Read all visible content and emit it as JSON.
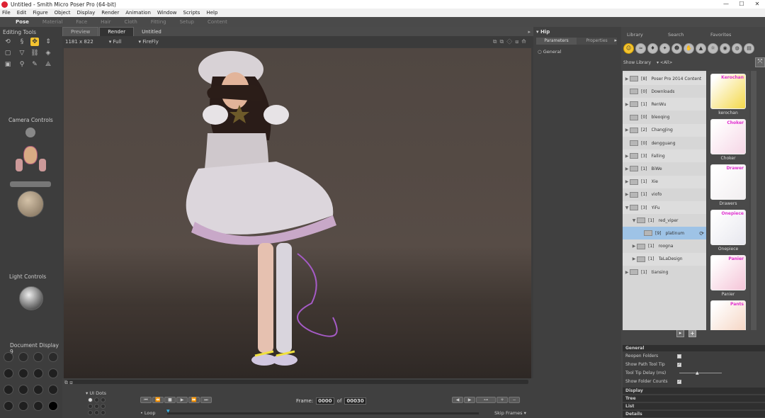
{
  "titlebar": {
    "title": "Untitled - Smith Micro Poser Pro  (64-bit)",
    "min": "—",
    "max": "☐",
    "close": "✕"
  },
  "menu": [
    "File",
    "Edit",
    "Figure",
    "Object",
    "Display",
    "Render",
    "Animation",
    "Window",
    "Scripts",
    "Help"
  ],
  "rooms": [
    "Pose",
    "Material",
    "Face",
    "Hair",
    "Cloth",
    "Fitting",
    "Setup",
    "Content"
  ],
  "left": {
    "editing_tools": "Editing Tools",
    "camera_controls": "Camera Controls",
    "light_controls": "Light Controls",
    "document_display": "Document Display 9"
  },
  "viewport": {
    "tabs": [
      "Preview",
      "Render"
    ],
    "doc_title": "Untitled",
    "resolution": "1181 x 822",
    "mode": "Full",
    "renderer": "FireFly"
  },
  "timeline": {
    "ui_dots": "UI Dots",
    "frame_label": "Frame:",
    "frame_value": "0000",
    "of_label": "of",
    "frame_total": "00030",
    "loop": "Loop",
    "skip_frames": "Skip Frames"
  },
  "params": {
    "title": "Hip",
    "tab_parameters": "Parameters",
    "tab_properties": "Properties",
    "group": "General"
  },
  "library": {
    "tabs": [
      "Library",
      "Search",
      "Favorites"
    ],
    "show_library": "Show Library",
    "show_value": "<All>",
    "folders": [
      {
        "count": "[8]",
        "name": "Poser Pro 2014 Content",
        "level": 0,
        "arrow": "▶"
      },
      {
        "count": "[0]",
        "name": "Downloads",
        "level": 0,
        "arrow": ""
      },
      {
        "count": "[1]",
        "name": "RenWu",
        "level": 0,
        "arrow": "▶"
      },
      {
        "count": "[0]",
        "name": "bleoqing",
        "level": 0,
        "arrow": ""
      },
      {
        "count": "[2]",
        "name": "ChangJing",
        "level": 0,
        "arrow": "▶"
      },
      {
        "count": "[0]",
        "name": "dengguang",
        "level": 0,
        "arrow": ""
      },
      {
        "count": "[3]",
        "name": "Falling",
        "level": 0,
        "arrow": "▶"
      },
      {
        "count": "[1]",
        "name": "BiWe",
        "level": 0,
        "arrow": "▶"
      },
      {
        "count": "[1]",
        "name": "Xie",
        "level": 0,
        "arrow": "▶"
      },
      {
        "count": "[1]",
        "name": "viofo",
        "level": 0,
        "arrow": "▶"
      },
      {
        "count": "[3]",
        "name": "YiFu",
        "level": 0,
        "arrow": "▼"
      },
      {
        "count": "[1]",
        "name": "red_viper",
        "level": 1,
        "arrow": "▼"
      },
      {
        "count": "[9]",
        "name": "platinum",
        "level": 2,
        "arrow": "",
        "sel": true
      },
      {
        "count": "[1]",
        "name": "roogna",
        "level": 1,
        "arrow": "▶"
      },
      {
        "count": "[1]",
        "name": "TaLaDesign",
        "level": 1,
        "arrow": "▶"
      },
      {
        "count": "[1]",
        "name": "tiansing",
        "level": 0,
        "arrow": "▶"
      }
    ],
    "thumbs": [
      {
        "label": "Kerochan",
        "caption": "kerochan",
        "color": "#f4d84a"
      },
      {
        "label": "Choker",
        "caption": "Choker",
        "color": "#f6d6e6"
      },
      {
        "label": "Drawer",
        "caption": "Drawers",
        "color": "#f2eef0"
      },
      {
        "label": "Onepiece",
        "caption": "Onepiece",
        "color": "#e7e7ee"
      },
      {
        "label": "Panier",
        "caption": "Panier",
        "color": "#f5c5d8"
      },
      {
        "label": "Pants",
        "caption": "",
        "color": "#f5d3c0"
      }
    ]
  },
  "general": {
    "header": "General",
    "rows": [
      {
        "label": "Reopen Folders",
        "checked": false
      },
      {
        "label": "Show Path Tool Tip",
        "checked": true
      },
      {
        "label": "Tool Tip Delay (ms)",
        "slider": true
      },
      {
        "label": "Show Folder Counts",
        "checked": true
      }
    ],
    "sections": [
      "Display",
      "Tree",
      "List",
      "Details"
    ]
  }
}
